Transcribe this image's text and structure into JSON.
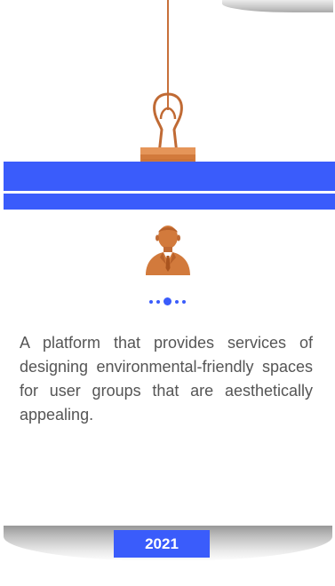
{
  "description": "A platform that provides services of designing environmental-friendly spaces for user groups that are aesthetically appealing.",
  "year": "2021",
  "pagination": {
    "total": 5,
    "active_index": 2
  },
  "icons": {
    "clip": "binder-clip-icon",
    "avatar": "person-avatar-icon"
  },
  "colors": {
    "accent": "#3a5cfb",
    "clip": "#d27a3c",
    "text": "#555555"
  }
}
